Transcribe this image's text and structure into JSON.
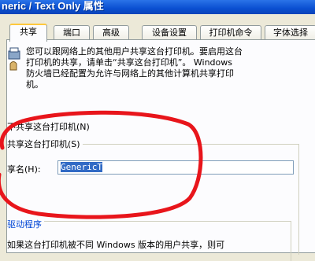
{
  "window": {
    "title": "neric / Text Only 属性"
  },
  "tabs": [
    {
      "label": "共享",
      "active": true
    },
    {
      "label": "端口",
      "active": false
    },
    {
      "label": "高级",
      "active": false
    },
    {
      "label": "设备设置",
      "active": false
    },
    {
      "label": "打印机命令",
      "active": false
    },
    {
      "label": "字体选择",
      "active": false
    }
  ],
  "share_intro": {
    "line1": "您可以跟网络上的其他用户共享这台打印机。要启用这台",
    "line2": "打印机的共享，请单击“共享这台打印机”。 Windows",
    "line3": "防火墙已经配置为允许与网络上的其他计算机共享打印",
    "line4": "机。"
  },
  "options": {
    "no_share": "不共享这台打印机(N)",
    "share": "共享这台打印机(S)",
    "selected": "share"
  },
  "share_name": {
    "label": "享名(H):",
    "value": "GenericT"
  },
  "drivers": {
    "title": "驱动程序",
    "text": "如果这台打印机被不同 Windows 版本的用户共享，则可"
  },
  "annotation_color": "#e8151b"
}
